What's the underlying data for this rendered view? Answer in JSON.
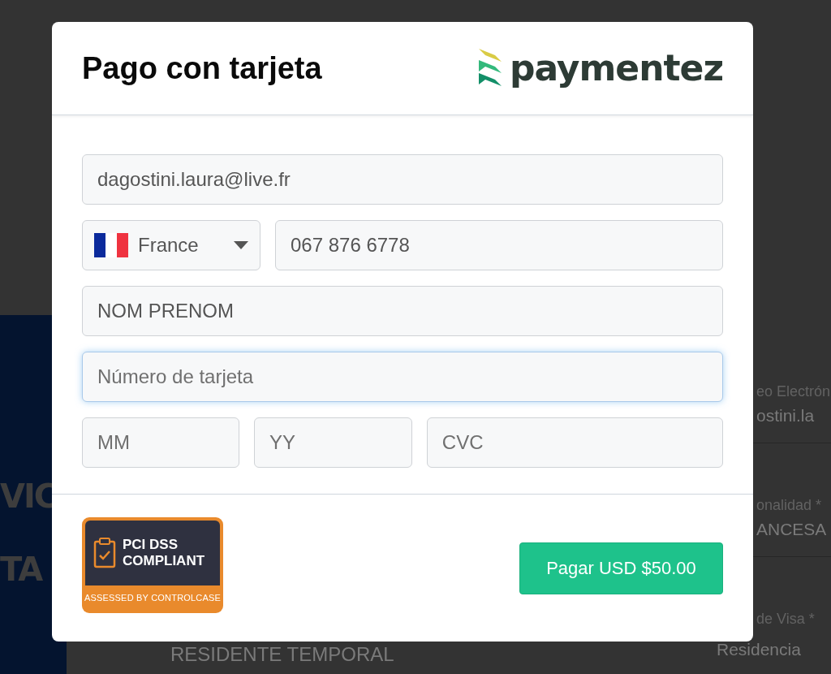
{
  "background": {
    "banner_text": [
      "VIC",
      "TA"
    ],
    "fields": [
      {
        "label": "eo Electrón",
        "value": "ostini.la"
      },
      {
        "label": "onalidad *",
        "value": "ANCESA"
      },
      {
        "label": "de Visa *",
        "value": "Residencia"
      }
    ],
    "lower_value": "RESIDENTE TEMPORAL"
  },
  "dialog": {
    "title": "Pago con tarjeta",
    "logo": "paymentez",
    "email": {
      "value": "dagostini.laura@live.fr"
    },
    "country": {
      "value": "France"
    },
    "phone": {
      "value": "067 876 6778"
    },
    "name": {
      "value": "NOM PRENOM"
    },
    "card_number": {
      "placeholder": "Número de tarjeta",
      "focused": true
    },
    "expiry_month": {
      "placeholder": "MM",
      "focused": false
    },
    "expiry_year": {
      "placeholder": "YY",
      "focused": false
    },
    "cvc": {
      "placeholder": "CVC",
      "focused": false
    },
    "badge": {
      "lines": [
        "PCI DSS",
        "COMPLIANT"
      ],
      "footer": "ASSESSED BY CONTROLCASE"
    },
    "pay_button": "Pagar USD $50.00"
  }
}
